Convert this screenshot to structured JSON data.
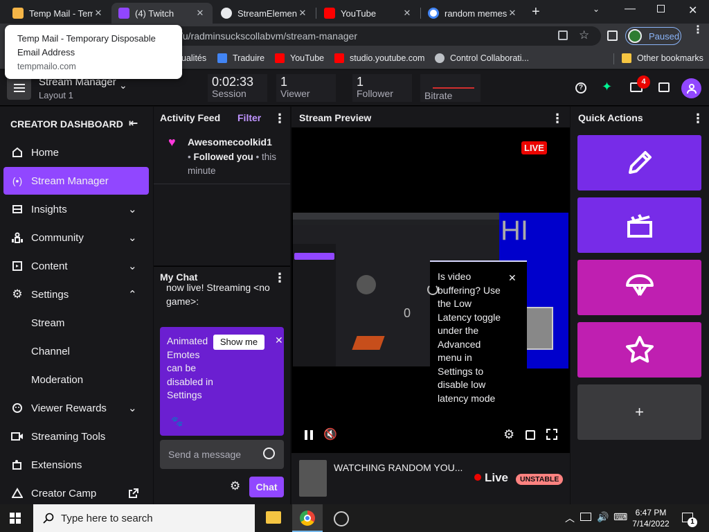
{
  "browser": {
    "tabs": [
      {
        "title": "Temp Mail - Tem",
        "icon": "envelope-icon",
        "color": "#f5b547"
      },
      {
        "title": "(4) Twitch",
        "icon": "twitch-icon",
        "color": "#9146ff"
      },
      {
        "title": "StreamElements",
        "icon": "streamelements-icon",
        "color": "#e8eaed"
      },
      {
        "title": "YouTube",
        "icon": "youtube-icon",
        "color": "#ff0000"
      },
      {
        "title": "random memes",
        "icon": "google-icon",
        "color": "#4285f4"
      }
    ],
    "url": "/u/radminsuckscollabvm/stream-manager",
    "profile_status": "Paused",
    "bookmarks": [
      "ualités",
      "Traduire",
      "YouTube",
      "studio.youtube.com",
      "Control Collaborati...",
      "Other bookmarks"
    ],
    "tooltip": {
      "title": "Temp Mail - Temporary Disposable Email Address",
      "url": "tempmailo.com"
    }
  },
  "topnav": {
    "title": "Stream Manager",
    "layout": "Layout 1",
    "session_value": "0:02:33",
    "session_label": "Session",
    "viewer_value": "1",
    "viewer_label": "Viewer",
    "follower_value": "1",
    "follower_label": "Follower",
    "bitrate_label": "Bitrate",
    "inbox_badge": "4"
  },
  "sidebar": {
    "header": "CREATOR DASHBOARD",
    "items": [
      {
        "label": "Home",
        "icon": "home-icon"
      },
      {
        "label": "Stream Manager",
        "icon": "broadcast-icon"
      },
      {
        "label": "Insights",
        "icon": "bar-chart-icon"
      },
      {
        "label": "Community",
        "icon": "community-icon"
      },
      {
        "label": "Content",
        "icon": "content-icon"
      },
      {
        "label": "Settings",
        "icon": "gear-icon"
      },
      {
        "label": "Stream"
      },
      {
        "label": "Channel"
      },
      {
        "label": "Moderation"
      },
      {
        "label": "Viewer Rewards",
        "icon": "rewards-icon"
      },
      {
        "label": "Streaming Tools",
        "icon": "camera-icon"
      },
      {
        "label": "Extensions",
        "icon": "puzzle-icon"
      },
      {
        "label": "Creator Camp",
        "icon": "external-link-icon"
      }
    ]
  },
  "activity": {
    "title": "Activity Feed",
    "filter": "Filter",
    "user": "Awesomecoolkid1",
    "action": "Followed you",
    "time": "this minute"
  },
  "chat": {
    "title": "My Chat",
    "message": "now live! Streaming <no game>:",
    "promo": "Animated Emotes can be disabled in Settings",
    "show_me": "Show me",
    "placeholder": "Send a message",
    "chat_button": "Chat"
  },
  "preview": {
    "title": "Stream Preview",
    "live_badge": "LIVE",
    "buffer_tip": "Is video buffering? Use the Low Latency toggle under the Advanced menu in Settings to disable low latency mode",
    "overlay_text": "HI",
    "stream_title": "WATCHING RANDOM YOU...",
    "live_label": "Live",
    "health": "UNSTABLE"
  },
  "quick_actions": {
    "title": "Quick Actions",
    "buttons": [
      {
        "icon": "pencil-icon",
        "color": "#772ce8"
      },
      {
        "icon": "clapperboard-icon",
        "color": "#772ce8"
      },
      {
        "icon": "parachute-icon",
        "color": "#bf1fb1"
      },
      {
        "icon": "star-icon",
        "color": "#bf1fb1"
      }
    ],
    "add_label": "+"
  },
  "taskbar": {
    "search_placeholder": "Type here to search",
    "time": "6:47 PM",
    "date": "7/14/2022",
    "notifications": "1"
  }
}
